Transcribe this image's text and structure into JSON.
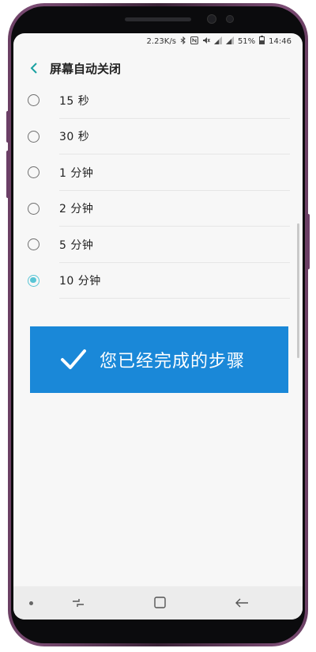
{
  "status_bar": {
    "speed": "2.23K/s",
    "battery": "51%",
    "time": "14:46",
    "icons": [
      "bluetooth-icon",
      "nfc-icon",
      "mute-icon",
      "signal-icon",
      "signal-icon",
      "battery-icon"
    ]
  },
  "app_bar": {
    "back_icon": "chevron-left-icon",
    "title": "屏幕自动关闭"
  },
  "options": [
    {
      "label": "15 秒",
      "selected": false
    },
    {
      "label": "30 秒",
      "selected": false
    },
    {
      "label": "1 分钟",
      "selected": false
    },
    {
      "label": "2 分钟",
      "selected": false
    },
    {
      "label": "5 分钟",
      "selected": false
    },
    {
      "label": "10 分钟",
      "selected": true
    }
  ],
  "banner": {
    "icon": "checkmark-icon",
    "text": "您已经完成的步骤"
  },
  "nav_bar": {
    "icons": [
      "dot-icon",
      "recent-apps-icon",
      "home-icon",
      "back-icon"
    ]
  },
  "colors": {
    "accent": "#59c5d5",
    "banner": "#1a88d8",
    "back": "#1aa1a1"
  }
}
